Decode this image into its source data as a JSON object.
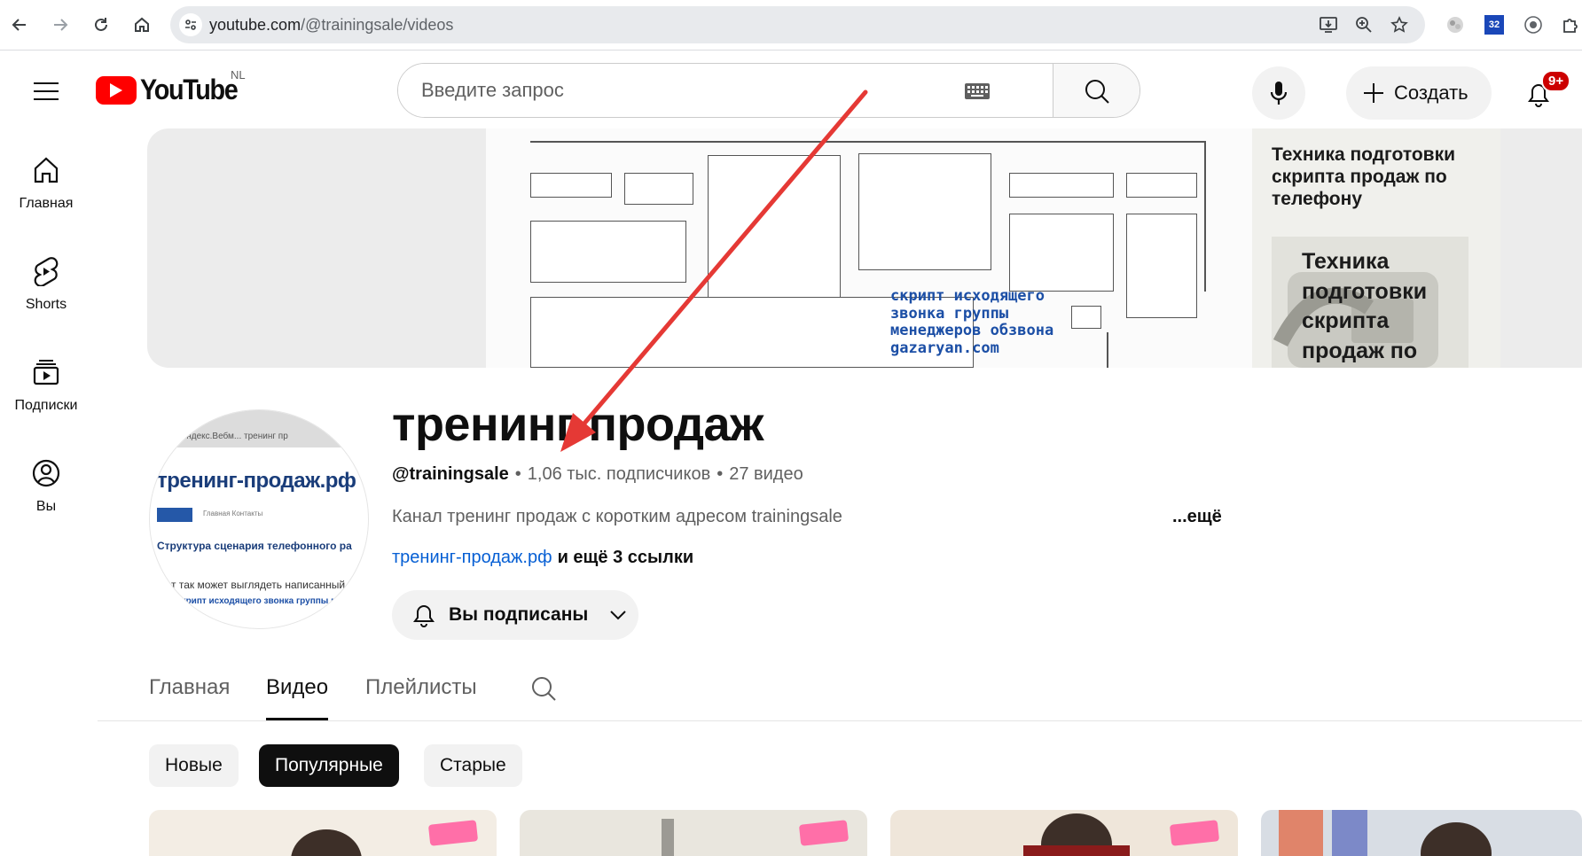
{
  "browser": {
    "url_host": "youtube.com",
    "url_path": "/@trainingsale/videos",
    "ext_badge": "32"
  },
  "header": {
    "logo_text": "YouTube",
    "region": "NL",
    "search_placeholder": "Введите запрос",
    "create_label": "Создать",
    "notifications_badge": "9+"
  },
  "sidebar": {
    "items": [
      {
        "label": "Главная",
        "icon": "home-icon"
      },
      {
        "label": "Shorts",
        "icon": "shorts-icon"
      },
      {
        "label": "Подписки",
        "icon": "subscriptions-icon"
      },
      {
        "label": "Вы",
        "icon": "you-icon"
      }
    ]
  },
  "banner": {
    "title": "Техника подготовки скрипта продаж по телефону",
    "image_caption": "Техника подготовки скрипта продаж по",
    "blue_text": "скрипт исходящего звонка группы менеджеров обзвона gazaryan.com"
  },
  "avatar": {
    "tabs_text": "Яндекс.Вебм...   тренинг пр",
    "site_title": "тренинг-продаж.рф",
    "nav_label": "Главная   Контакты",
    "heading": "Структура сценария телефонного ра",
    "body_line": "т так может выглядеть написанный",
    "blue_line": "скрипт исходящего звонка группы м"
  },
  "channel": {
    "name": "тренинг продаж",
    "handle": "@trainingsale",
    "subscribers": "1,06 тыс. подписчиков",
    "videos": "27 видео",
    "separator": "•",
    "description": "Канал тренинг продаж с коротким адресом trainingsale",
    "more": "...ещё",
    "site_link": "тренинг-продаж.рф",
    "more_links": "и ещё 3 ссылки",
    "subscribe_label": "Вы подписаны"
  },
  "tabs": [
    {
      "label": "Главная",
      "active": false
    },
    {
      "label": "Видео",
      "active": true
    },
    {
      "label": "Плейлисты",
      "active": false
    }
  ],
  "chips": [
    {
      "label": "Новые",
      "active": false
    },
    {
      "label": "Популярные",
      "active": true
    },
    {
      "label": "Старые",
      "active": false
    }
  ],
  "colors": {
    "brand_red": "#ff0000",
    "link_blue": "#065fd4",
    "annotation_arrow": "#e53935"
  }
}
